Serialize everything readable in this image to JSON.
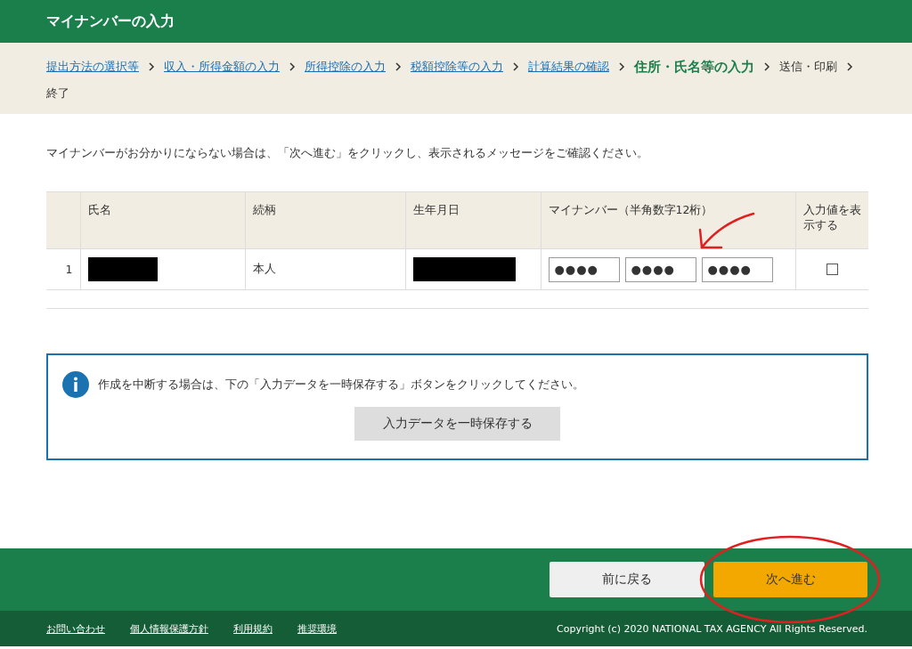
{
  "header": {
    "title": "マイナンバーの入力"
  },
  "breadcrumb": [
    {
      "label": "提出方法の選択等",
      "kind": "link"
    },
    {
      "label": "収入・所得金額の入力",
      "kind": "link"
    },
    {
      "label": "所得控除の入力",
      "kind": "link"
    },
    {
      "label": "税額控除等の入力",
      "kind": "link"
    },
    {
      "label": "計算結果の確認",
      "kind": "link"
    },
    {
      "label": "住所・氏名等の入力",
      "kind": "current"
    },
    {
      "label": "送信・印刷",
      "kind": "plain"
    },
    {
      "label": "終了",
      "kind": "plain"
    }
  ],
  "message": "マイナンバーがお分かりにならない場合は、「次へ進む」をクリックし、表示されるメッセージをご確認ください。",
  "table": {
    "columns": [
      "氏名",
      "続柄",
      "生年月日",
      "マイナンバー（半角数字12桁）",
      "入力値を表示する"
    ],
    "rows": [
      {
        "index": "1",
        "relation": "本人",
        "number_parts": [
          "●●●●",
          "●●●●",
          "●●●●"
        ],
        "show_value": false
      }
    ]
  },
  "info": {
    "text": "作成を中断する場合は、下の「入力データを一時保存する」ボタンをクリックしてください。",
    "button": "入力データを一時保存する"
  },
  "nav": {
    "back": "前に戻る",
    "next": "次へ進む"
  },
  "footer": {
    "links": [
      "お問い合わせ",
      "個人情報保護方針",
      "利用規約",
      "推奨環境"
    ],
    "copyright": "Copyright (c) 2020 NATIONAL TAX AGENCY All Rights Reserved."
  }
}
